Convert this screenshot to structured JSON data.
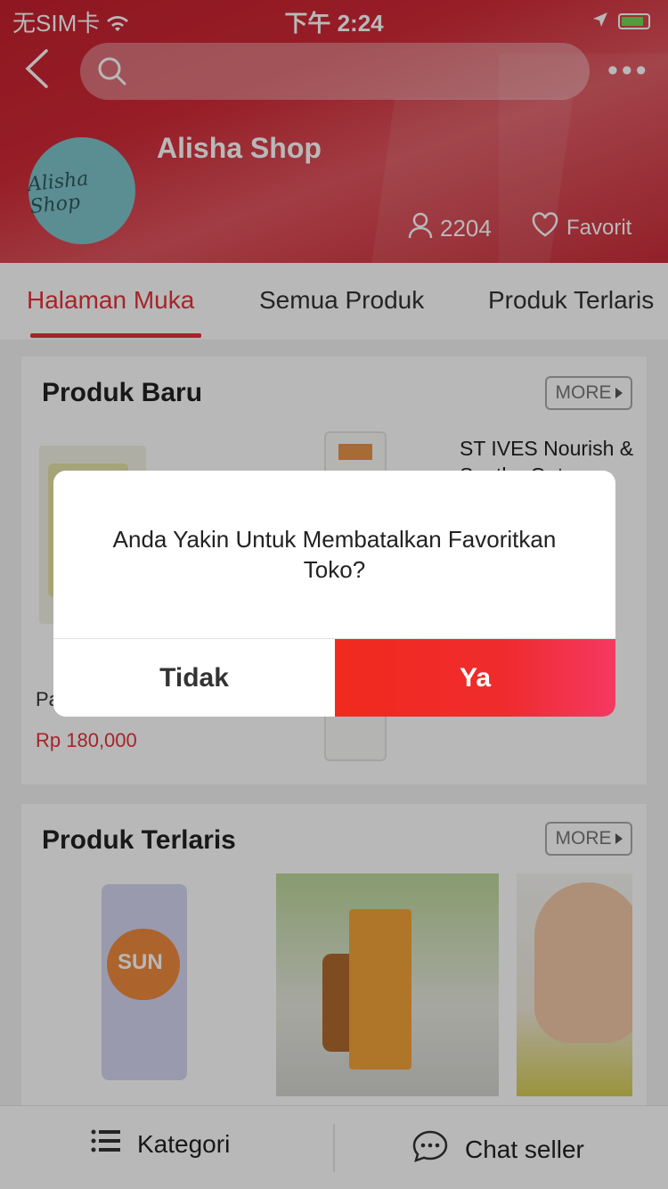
{
  "status_bar": {
    "carrier": "无SIM卡",
    "time": "下午 2:24"
  },
  "search": {
    "placeholder": ""
  },
  "shop": {
    "name": "Alisha Shop",
    "avatar_text": "Alisha Shop",
    "followers": "2204",
    "favorite_label": "Favorit"
  },
  "tabs": [
    {
      "label": "Halaman Muka",
      "active": true
    },
    {
      "label": "Semua Produk",
      "active": false
    },
    {
      "label": "Produk Terlaris",
      "active": false
    }
  ],
  "new_products": {
    "title": "Produk Baru",
    "more_label": "MORE",
    "item_right_title": "ST IVES Nourish & Soothe Oatm...",
    "item_left_name": "Pa",
    "item_left_price": "Rp 180,000"
  },
  "best_sellers": {
    "title": "Produk Terlaris",
    "more_label": "MORE",
    "item1_label": "SUN"
  },
  "bottom_bar": {
    "category_label": "Kategori",
    "chat_label": "Chat seller"
  },
  "dialog": {
    "message": "Anda Yakin Untuk Membatalkan Favoritkan Toko?",
    "cancel_label": "Tidak",
    "confirm_label": "Ya"
  },
  "colors": {
    "brand_red": "#e53238",
    "header_red": "#c6202e",
    "confirm_gradient_end": "#f43962"
  }
}
